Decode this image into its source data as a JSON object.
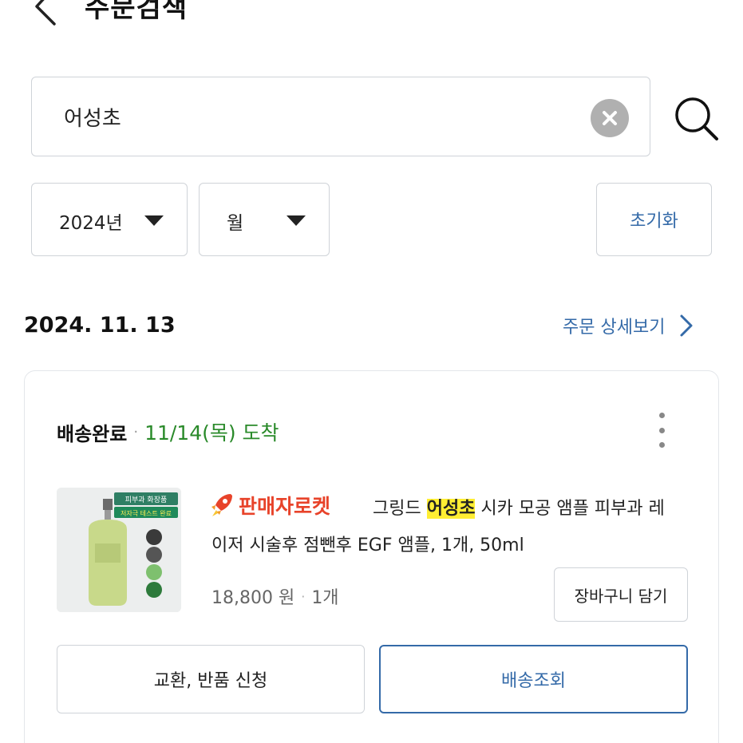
{
  "header": {
    "title": "주문검색"
  },
  "search": {
    "value": "어성초"
  },
  "filters": {
    "year": "2024년",
    "month": "월",
    "reset_label": "초기화"
  },
  "order": {
    "date": "2024. 11. 13",
    "detail_link": "주문 상세보기",
    "status": "배송완료",
    "arrival": "11/14(목) 도착",
    "badge": "판매자로켓",
    "product": {
      "name_before": "그링드 ",
      "name_highlight": "어성초",
      "name_after": " 시카 모공 앰플 피부과 레",
      "name_line2": "이저 시술후 점뺀후 EGF 앰플, 1개, 50ml",
      "price": "18,800 원",
      "quantity": "1개",
      "thumb_banner_top": "피부과 화장품",
      "thumb_banner_bottom": "저자극 테스트 완료"
    },
    "cart_button": "장바구니 담기",
    "return_button": "교환, 반품 신청",
    "track_button": "배송조회"
  },
  "colors": {
    "accent_blue": "#346aa8",
    "arrival_green": "#2a8a2a",
    "badge_red": "#e8432a",
    "highlight_yellow": "#ffee33"
  },
  "icons": [
    "chevron-left-icon",
    "clear-icon",
    "search-icon",
    "caret-down-icon",
    "chevron-right-icon",
    "more-vertical-icon",
    "rocket-icon"
  ]
}
